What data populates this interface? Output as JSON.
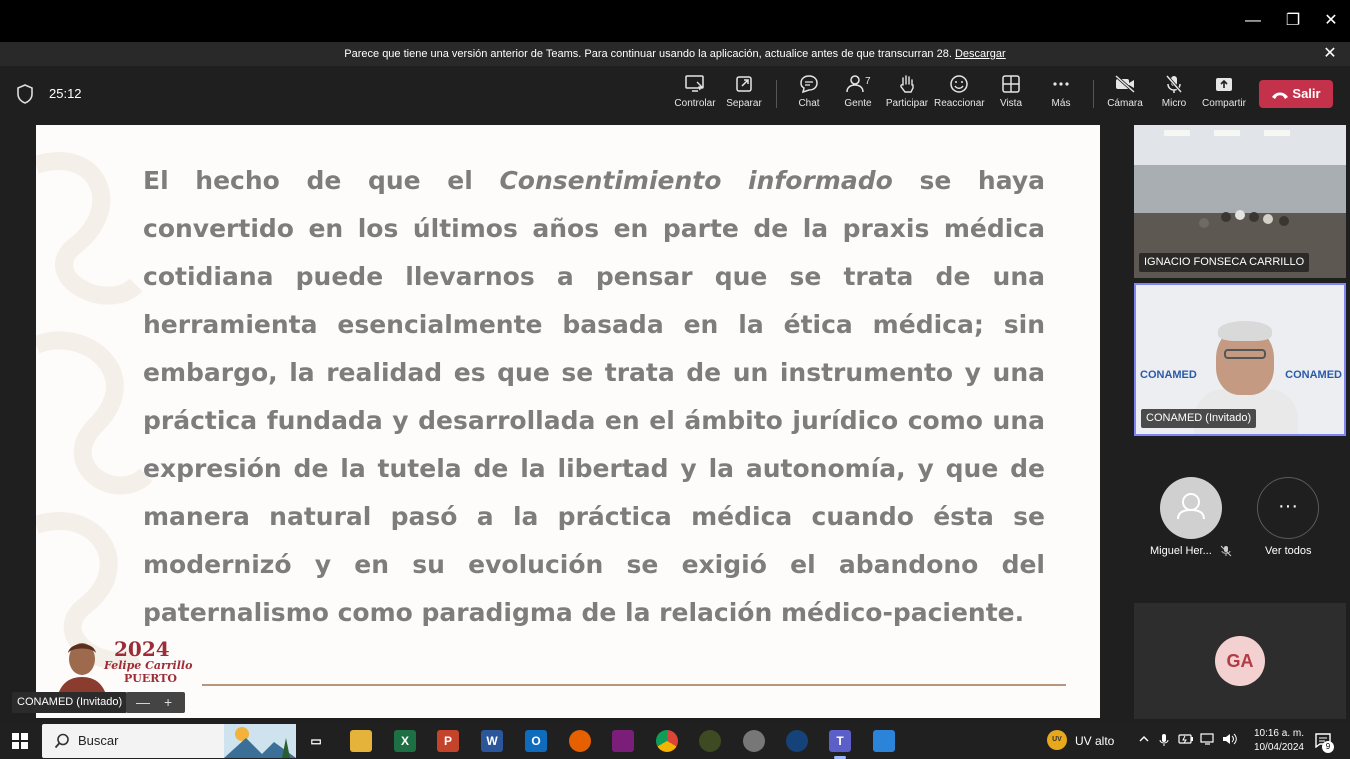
{
  "window": {
    "controls": [
      "—",
      "❐",
      "✕"
    ]
  },
  "notice": {
    "text": "Parece que tiene una versión anterior de Teams. Para continuar usando la aplicación, actualice antes de que transcurran 28.",
    "link": "Descargar",
    "close": "✕"
  },
  "toolbar": {
    "timer": "25:12",
    "buttons": [
      {
        "label": "Controlar"
      },
      {
        "label": "Separar"
      },
      {
        "label": "Chat"
      },
      {
        "label": "Gente",
        "count": "7"
      },
      {
        "label": "Participar"
      },
      {
        "label": "Reaccionar"
      },
      {
        "label": "Vista"
      },
      {
        "label": "Más"
      },
      {
        "label": "Cámara"
      },
      {
        "label": "Micro"
      },
      {
        "label": "Compartir"
      }
    ],
    "leave_label": "Salir"
  },
  "slide": {
    "text_before": "El hecho de que el ",
    "text_italic": "Consentimiento informado",
    "text_after": " se haya convertido en los últimos años en parte de la praxis médica cotidiana puede llevarnos a pensar que se trata de una herramienta esencialmente basada en la ética médica; sin embargo, la realidad es que se trata de un instrumento y una práctica fundada y desarrollada en el ámbito jurídico como una expresión de la tutela de la libertad y la autonomía, y que de manera natural pasó a la práctica médica cuando ésta se modernizó y en su evolución se exigió el abandono del paternalismo como paradigma de la relación médico-paciente.",
    "logo_year": "2024",
    "logo_name": "Felipe Carrillo",
    "logo_name2": "PUERTO"
  },
  "presenter": {
    "label": "CONAMED (Invitado)",
    "zoom_minus": "—",
    "zoom_plus": "+"
  },
  "participants": {
    "tile1_name": "IGNACIO FONSECA CARRILLO",
    "tile2_name": "CONAMED (Invitado)",
    "tile2_logo": "CONAMED",
    "person_name": "Miguel Her...",
    "see_all": "Ver todos",
    "more": "···",
    "ga_initials": "GA"
  },
  "taskbar": {
    "search_placeholder": "Buscar",
    "weather": "UV alto",
    "weather_badge": "UV",
    "time": "10:16 a. m.",
    "date": "10/04/2024",
    "notif_count": "9",
    "apps": [
      {
        "name": "task-view",
        "glyph": "▭",
        "color": "#202020"
      },
      {
        "name": "file-explorer",
        "glyph": "",
        "color": "#e6b33a"
      },
      {
        "name": "excel",
        "glyph": "X",
        "color": "#1d7044"
      },
      {
        "name": "powerpoint",
        "glyph": "P",
        "color": "#c4442b"
      },
      {
        "name": "word",
        "glyph": "W",
        "color": "#2b579a"
      },
      {
        "name": "outlook",
        "glyph": "O",
        "color": "#0f6cbd"
      },
      {
        "name": "firefox",
        "glyph": "",
        "color": "#e66000"
      },
      {
        "name": "app-misc",
        "glyph": "",
        "color": "#7a1e7a"
      },
      {
        "name": "chrome",
        "glyph": "",
        "color": "#3a9d4d"
      },
      {
        "name": "app-game",
        "glyph": "",
        "color": "#3d4a22"
      },
      {
        "name": "app-puzzle",
        "glyph": "",
        "color": "#777"
      },
      {
        "name": "app-webex",
        "glyph": "",
        "color": "#16427a"
      },
      {
        "name": "teams",
        "glyph": "T",
        "color": "#5b5fc7"
      },
      {
        "name": "app-paint",
        "glyph": "",
        "color": "#2c84d9"
      }
    ]
  }
}
